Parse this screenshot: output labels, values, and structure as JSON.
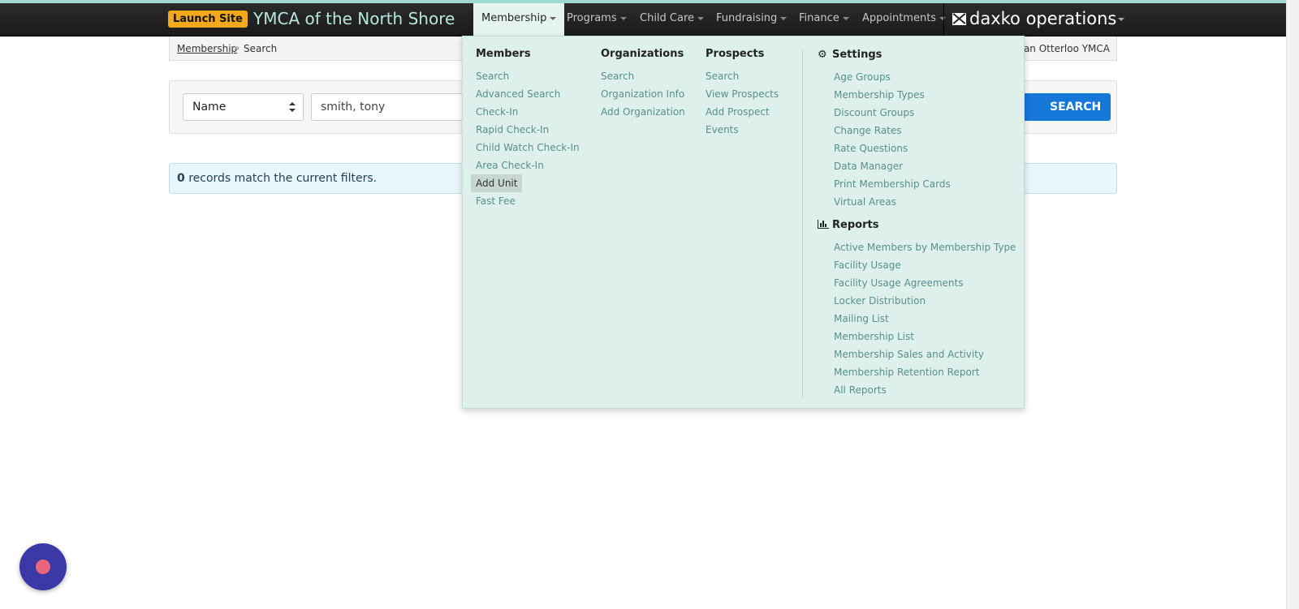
{
  "header": {
    "launch_label": "Launch Site",
    "brand": "YMCA of the North Shore",
    "nav": [
      "Membership",
      "Programs",
      "Child Care",
      "Fundraising",
      "Finance",
      "Appointments"
    ],
    "product": "daxko operations"
  },
  "breadcrumb": {
    "link": "Membership",
    "separator": "»",
    "current": "Search",
    "association": "van Otterloo YMCA"
  },
  "search": {
    "filter_selected": "Name",
    "query_value": "smith, tony",
    "button_label": "SEARCH"
  },
  "results": {
    "count": "0",
    "message": "records match the current filters."
  },
  "menu": {
    "members": {
      "title": "Members",
      "items": [
        "Search",
        "Advanced Search",
        "Check-In",
        "Rapid Check-In",
        "Child Watch Check-In",
        "Area Check-In",
        "Add Unit",
        "Fast Fee"
      ]
    },
    "organizations": {
      "title": "Organizations",
      "items": [
        "Search",
        "Organization Info",
        "Add Organization"
      ]
    },
    "prospects": {
      "title": "Prospects",
      "items": [
        "Search",
        "View Prospects",
        "Add Prospect",
        "Events"
      ]
    },
    "settings": {
      "title": "Settings",
      "items": [
        "Age Groups",
        "Membership Types",
        "Discount Groups",
        "Change Rates",
        "Rate Questions",
        "Data Manager",
        "Print Membership Cards",
        "Virtual Areas"
      ]
    },
    "reports": {
      "title": "Reports",
      "items": [
        "Active Members by Membership Type",
        "Facility Usage",
        "Facility Usage Agreements",
        "Locker Distribution",
        "Mailing List",
        "Membership List",
        "Membership Sales and Activity",
        "Membership Retention Report",
        "All Reports"
      ]
    }
  },
  "colors": {
    "navbar": "#1e1e1e",
    "brand_text": "#b7e6de",
    "launch_badge": "#f2a91c",
    "dropdown_bg": "#ddf0ec",
    "link": "#5a8f8a",
    "search_button": "#1577d8",
    "chat_bubble": "#3c39a6"
  },
  "icons": [
    "gear-icon",
    "bar-chart-icon",
    "envelope-logo-icon",
    "chat-icon"
  ]
}
